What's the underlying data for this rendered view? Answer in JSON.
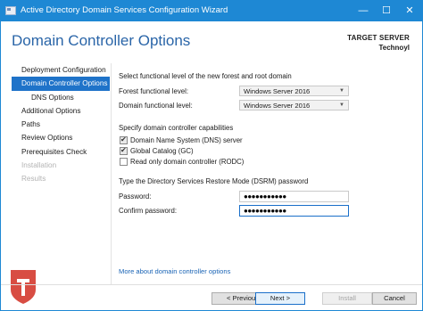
{
  "window": {
    "title": "Active Directory Domain Services Configuration Wizard",
    "controls": {
      "minimize": "—",
      "maximize": "☐",
      "close": "✕"
    }
  },
  "header": {
    "title": "Domain Controller Options",
    "target_label": "TARGET SERVER",
    "target_server": "Technoyl"
  },
  "nav": {
    "items": [
      {
        "label": "Deployment Configuration",
        "state": "normal"
      },
      {
        "label": "Domain Controller Options",
        "state": "selected"
      },
      {
        "label": "DNS Options",
        "state": "sub"
      },
      {
        "label": "Additional Options",
        "state": "normal"
      },
      {
        "label": "Paths",
        "state": "normal"
      },
      {
        "label": "Review Options",
        "state": "normal"
      },
      {
        "label": "Prerequisites Check",
        "state": "normal"
      },
      {
        "label": "Installation",
        "state": "disabled"
      },
      {
        "label": "Results",
        "state": "disabled"
      }
    ]
  },
  "form": {
    "intro": "Select functional level of the new forest and root domain",
    "forest_level_label": "Forest functional level:",
    "forest_level_value": "Windows Server 2016",
    "domain_level_label": "Domain functional level:",
    "domain_level_value": "Windows Server 2016",
    "capabilities_heading": "Specify domain controller capabilities",
    "capabilities": [
      {
        "label": "Domain Name System (DNS) server",
        "checked": true
      },
      {
        "label": "Global Catalog (GC)",
        "checked": true
      },
      {
        "label": "Read only domain controller (RODC)",
        "checked": false
      }
    ],
    "dsrm_heading": "Type the Directory Services Restore Mode (DSRM) password",
    "password_label": "Password:",
    "password_value": "●●●●●●●●●●●",
    "confirm_label": "Confirm password:",
    "confirm_value": "●●●●●●●●●●●"
  },
  "more_link": "More about domain controller options",
  "buttons": {
    "previous": "< Previous",
    "next": "Next >",
    "install": "Install",
    "cancel": "Cancel"
  },
  "colors": {
    "titlebar": "#1e88d4",
    "selected_nav": "#1f73c9",
    "header_title": "#2a65a8",
    "link": "#1a64b5"
  }
}
